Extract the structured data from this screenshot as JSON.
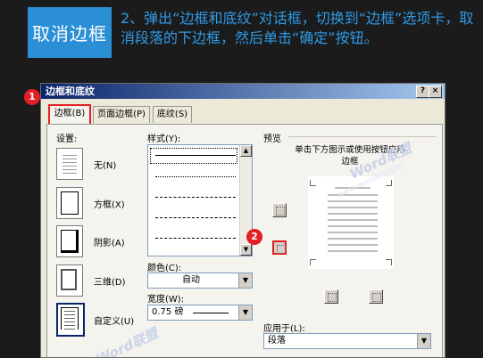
{
  "banner": {
    "tag": "取消边框",
    "instruction": "2、弹出“边框和底纹”对话框，切换到“边框”选项卡，取消段落的下边框，然后单击“确定”按钮。",
    "tag_color": "#2b8fd6",
    "text_color": "#2f9ae6"
  },
  "dialog": {
    "title": "边框和底纹",
    "help": "?",
    "close": "×",
    "tabs": [
      "边框(B)",
      "页面边框(P)",
      "底纹(S)"
    ],
    "settings_label": "设置:",
    "settings": [
      "无(N)",
      "方框(X)",
      "阴影(A)",
      "三维(D)",
      "自定义(U)"
    ],
    "style_label": "样式(Y):",
    "color_label": "颜色(C):",
    "color_value": "自动",
    "width_label": "宽度(W):",
    "width_value": "0.75 磅",
    "preview_label": "预览",
    "preview_hint": "单击下方图示或使用按钮应用边框",
    "apply_label": "应用于(L):",
    "apply_value": "段落"
  },
  "markers": {
    "one": "1",
    "two": "2",
    "color": "#e31e24"
  },
  "watermark": {
    "brand": "Word联盟",
    "url": "www.wordlm.com"
  }
}
